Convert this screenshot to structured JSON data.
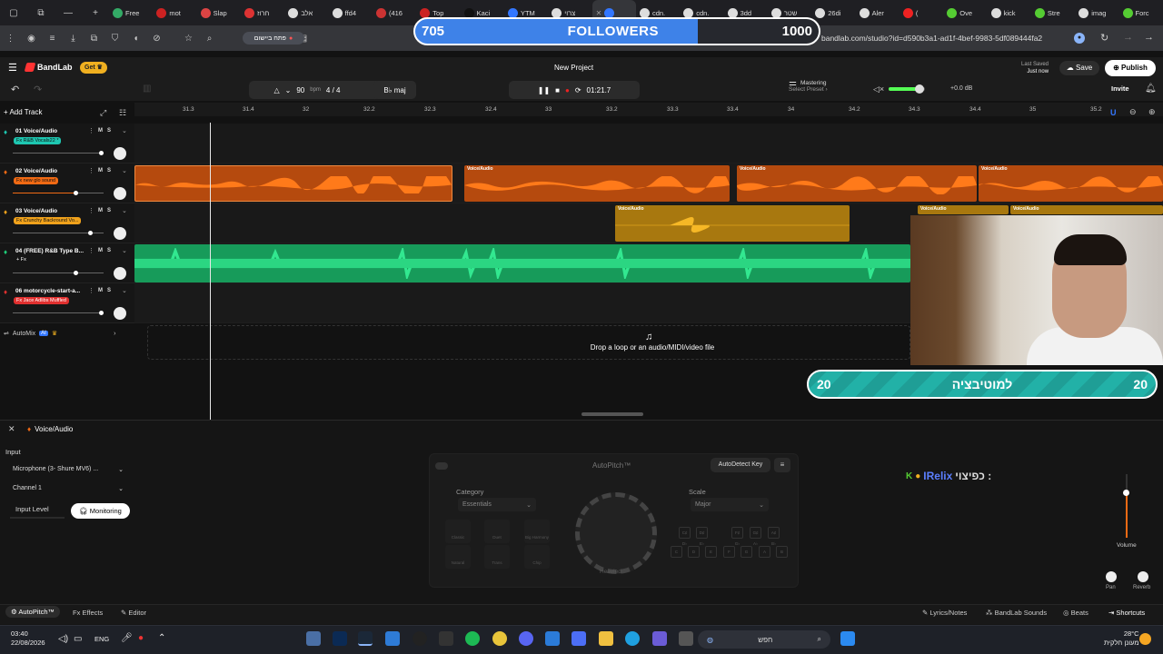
{
  "browser": {
    "tabs": [
      "Free",
      "mot",
      "Slap",
      "חרוז",
      "אלב",
      "ffd4",
      "(416",
      "Top",
      "Kaci",
      "YTM",
      "צרוי",
      "",
      "cdn.",
      "cdn.",
      "3dd",
      "שטר",
      "26di",
      "Aler",
      "(",
      "Ove",
      "kick",
      "Stre",
      "imag",
      "Forc"
    ],
    "url": "bandlab.com/studio?id=d590b3a1-ad1f-4bef-9983-5df089444fa2",
    "app_button": "פתח ביישום"
  },
  "followers_overlay": {
    "current": "705",
    "label": "FOLLOWERS",
    "goal": "1000",
    "progress": 0.705
  },
  "header": {
    "logo": "BandLab",
    "get_button": "Get",
    "project_name": "New Project",
    "last_saved_label": "Last Saved",
    "last_saved_value": "Just now",
    "save_label": "Save",
    "publish_label": "Publish"
  },
  "transport": {
    "bpm": "90",
    "bpm_unit": "bpm",
    "time_signature": "4 / 4",
    "key": "B♭ maj",
    "time": "01:21.7",
    "mastering_label": "Mastering",
    "mastering_preset": "Select Preset ›",
    "master_volume": "+0.0 dB",
    "invite_label": "Invite"
  },
  "ruler_ticks": [
    "31.3",
    "31.4",
    "32",
    "32.2",
    "32.3",
    "32.4",
    "33",
    "33.2",
    "33.3",
    "33.4",
    "34",
    "34.2",
    "34.3",
    "34.4",
    "35",
    "35.2"
  ],
  "add_track_label": "Add Track",
  "tracks": [
    {
      "num": "01",
      "name": "Voice/Audio",
      "fx": "Fx R&B Vocals22 *",
      "color": "#1ec7b1",
      "mute": "M",
      "solo": "S"
    },
    {
      "num": "02",
      "name": "Voice/Audio",
      "fx": "Fx new glo sound",
      "color": "#f16a14",
      "mute": "M",
      "solo": "S"
    },
    {
      "num": "03",
      "name": "Voice/Audio",
      "fx": "Fx Crunchy Backround Vo...",
      "color": "#f0a21c",
      "mute": "M",
      "solo": "S"
    },
    {
      "num": "04",
      "name": "(FREE) R&B Type B...",
      "fx": "+ Fx",
      "color": "#1fce7a",
      "mute": "M",
      "solo": "S"
    },
    {
      "num": "06",
      "name": "motorcycle-start-a...",
      "fx": "Fx Jace Adlibs Muffled",
      "color": "#e0302f",
      "mute": "M",
      "solo": "S"
    }
  ],
  "clip_label": "Voice/Audio",
  "automix": {
    "label": "AutoMix",
    "badge": "AI"
  },
  "drop_text": "Drop a loop or an audio/MIDI/video file",
  "motivation_overlay": {
    "left": "20",
    "text": "למוטיבציה",
    "right": "20"
  },
  "panel": {
    "title": "Voice/Audio",
    "input_label": "Input",
    "input_device": "Microphone (3- Shure MV6) ...",
    "channel": "Channel 1",
    "input_level_label": "Input Level",
    "monitoring_label": "Monitoring",
    "autopitch_title": "AutoPitch™",
    "autodetect_label": "AutoDetect Key",
    "category_label": "Category",
    "category_value": "Essentials",
    "scale_label": "Scale",
    "scale_value": "Major",
    "knob_label": "Heavied",
    "grid": [
      "Classic",
      "Duet",
      "Big Harmony",
      "Natural",
      "Trans",
      "Chip"
    ],
    "keys_top": [
      "C♯ D♭",
      "D♯ E♭",
      "F♯ G♭",
      "G♯ A♭",
      "A♯ B♭"
    ],
    "keys_bottom": [
      "C",
      "D",
      "E",
      "F",
      "G",
      "A",
      "B"
    ],
    "volume_label": "Volume",
    "pan_label": "Pan",
    "reverb_label": "Reverb"
  },
  "chat": {
    "user": "IRelix",
    "prefix": "כפיצוי :"
  },
  "bottom_tabs": [
    "AutoPitch™",
    "Effects",
    "Editor",
    "Lyrics/Notes",
    "BandLab Sounds",
    "Beats",
    "Shortcuts"
  ],
  "taskbar": {
    "time": "03:40",
    "date": "22/08/2026",
    "lang": "ENG",
    "search_placeholder": "חפש",
    "weather_temp": "28°C",
    "weather_text": "מעונן חלקית"
  }
}
